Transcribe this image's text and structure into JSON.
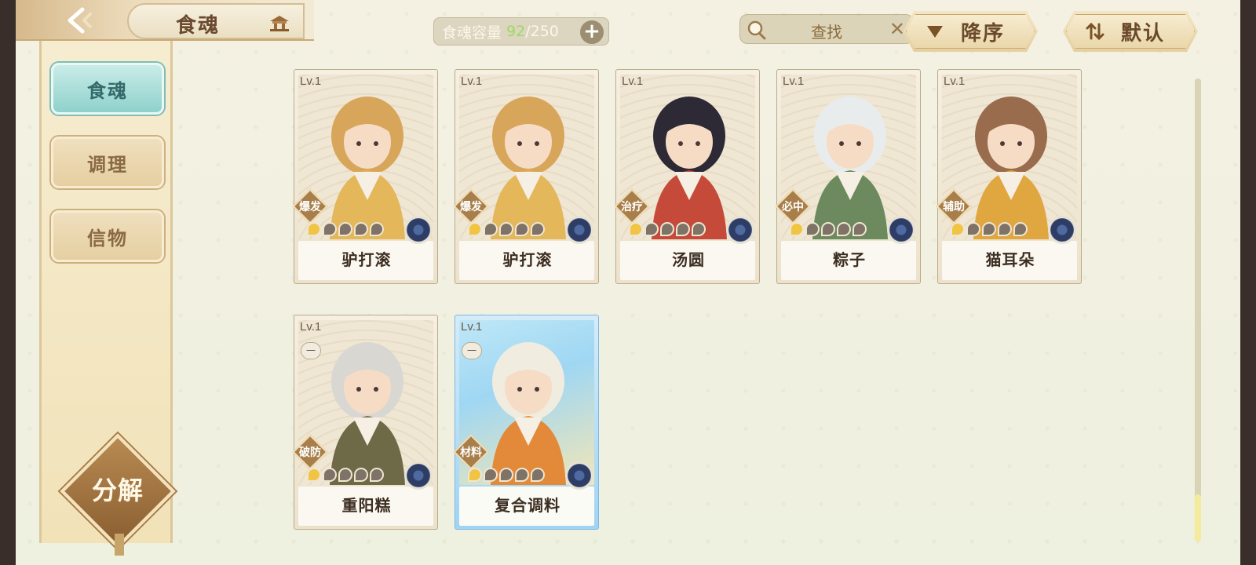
{
  "header": {
    "title": "食魂"
  },
  "capacity": {
    "label": "食魂容量",
    "current": "92",
    "max": "/250"
  },
  "search": {
    "placeholder": "查找"
  },
  "sort": {
    "order_label": "降序",
    "mode_label": "默认"
  },
  "sidebar": {
    "items": [
      {
        "label": "食魂",
        "active": true
      },
      {
        "label": "调理",
        "active": false
      },
      {
        "label": "信物",
        "active": false
      }
    ],
    "decompose_label": "分解"
  },
  "cards": [
    {
      "level": "Lv.1",
      "role": "爆发",
      "name": "驴打滚",
      "stars_lit": 1,
      "stars_total": 5,
      "hair": "#d8a65a",
      "robe": "#e3b75a"
    },
    {
      "level": "Lv.1",
      "role": "爆发",
      "name": "驴打滚",
      "stars_lit": 1,
      "stars_total": 5,
      "hair": "#d8a65a",
      "robe": "#e3b75a"
    },
    {
      "level": "Lv.1",
      "role": "治疗",
      "name": "汤圆",
      "stars_lit": 1,
      "stars_total": 5,
      "hair": "#2d2a35",
      "robe": "#c64a3a"
    },
    {
      "level": "Lv.1",
      "role": "必中",
      "name": "粽子",
      "stars_lit": 1,
      "stars_total": 5,
      "hair": "#e9ecec",
      "robe": "#6c8a5e"
    },
    {
      "level": "Lv.1",
      "role": "辅助",
      "name": "猫耳朵",
      "stars_lit": 1,
      "stars_total": 5,
      "hair": "#9a6c4e",
      "robe": "#e0a640"
    },
    {
      "level": "Lv.1",
      "role": "破防",
      "name": "重阳糕",
      "stars_lit": 1,
      "stars_total": 5,
      "hair": "#d9d7d2",
      "robe": "#6e6a48",
      "badge": "一"
    },
    {
      "level": "Lv.1",
      "role": "材料",
      "name": "复合调料",
      "stars_lit": 1,
      "stars_total": 5,
      "hair": "#f1ece0",
      "robe": "#e38a3a",
      "badge": "一",
      "variant": "blue"
    }
  ]
}
